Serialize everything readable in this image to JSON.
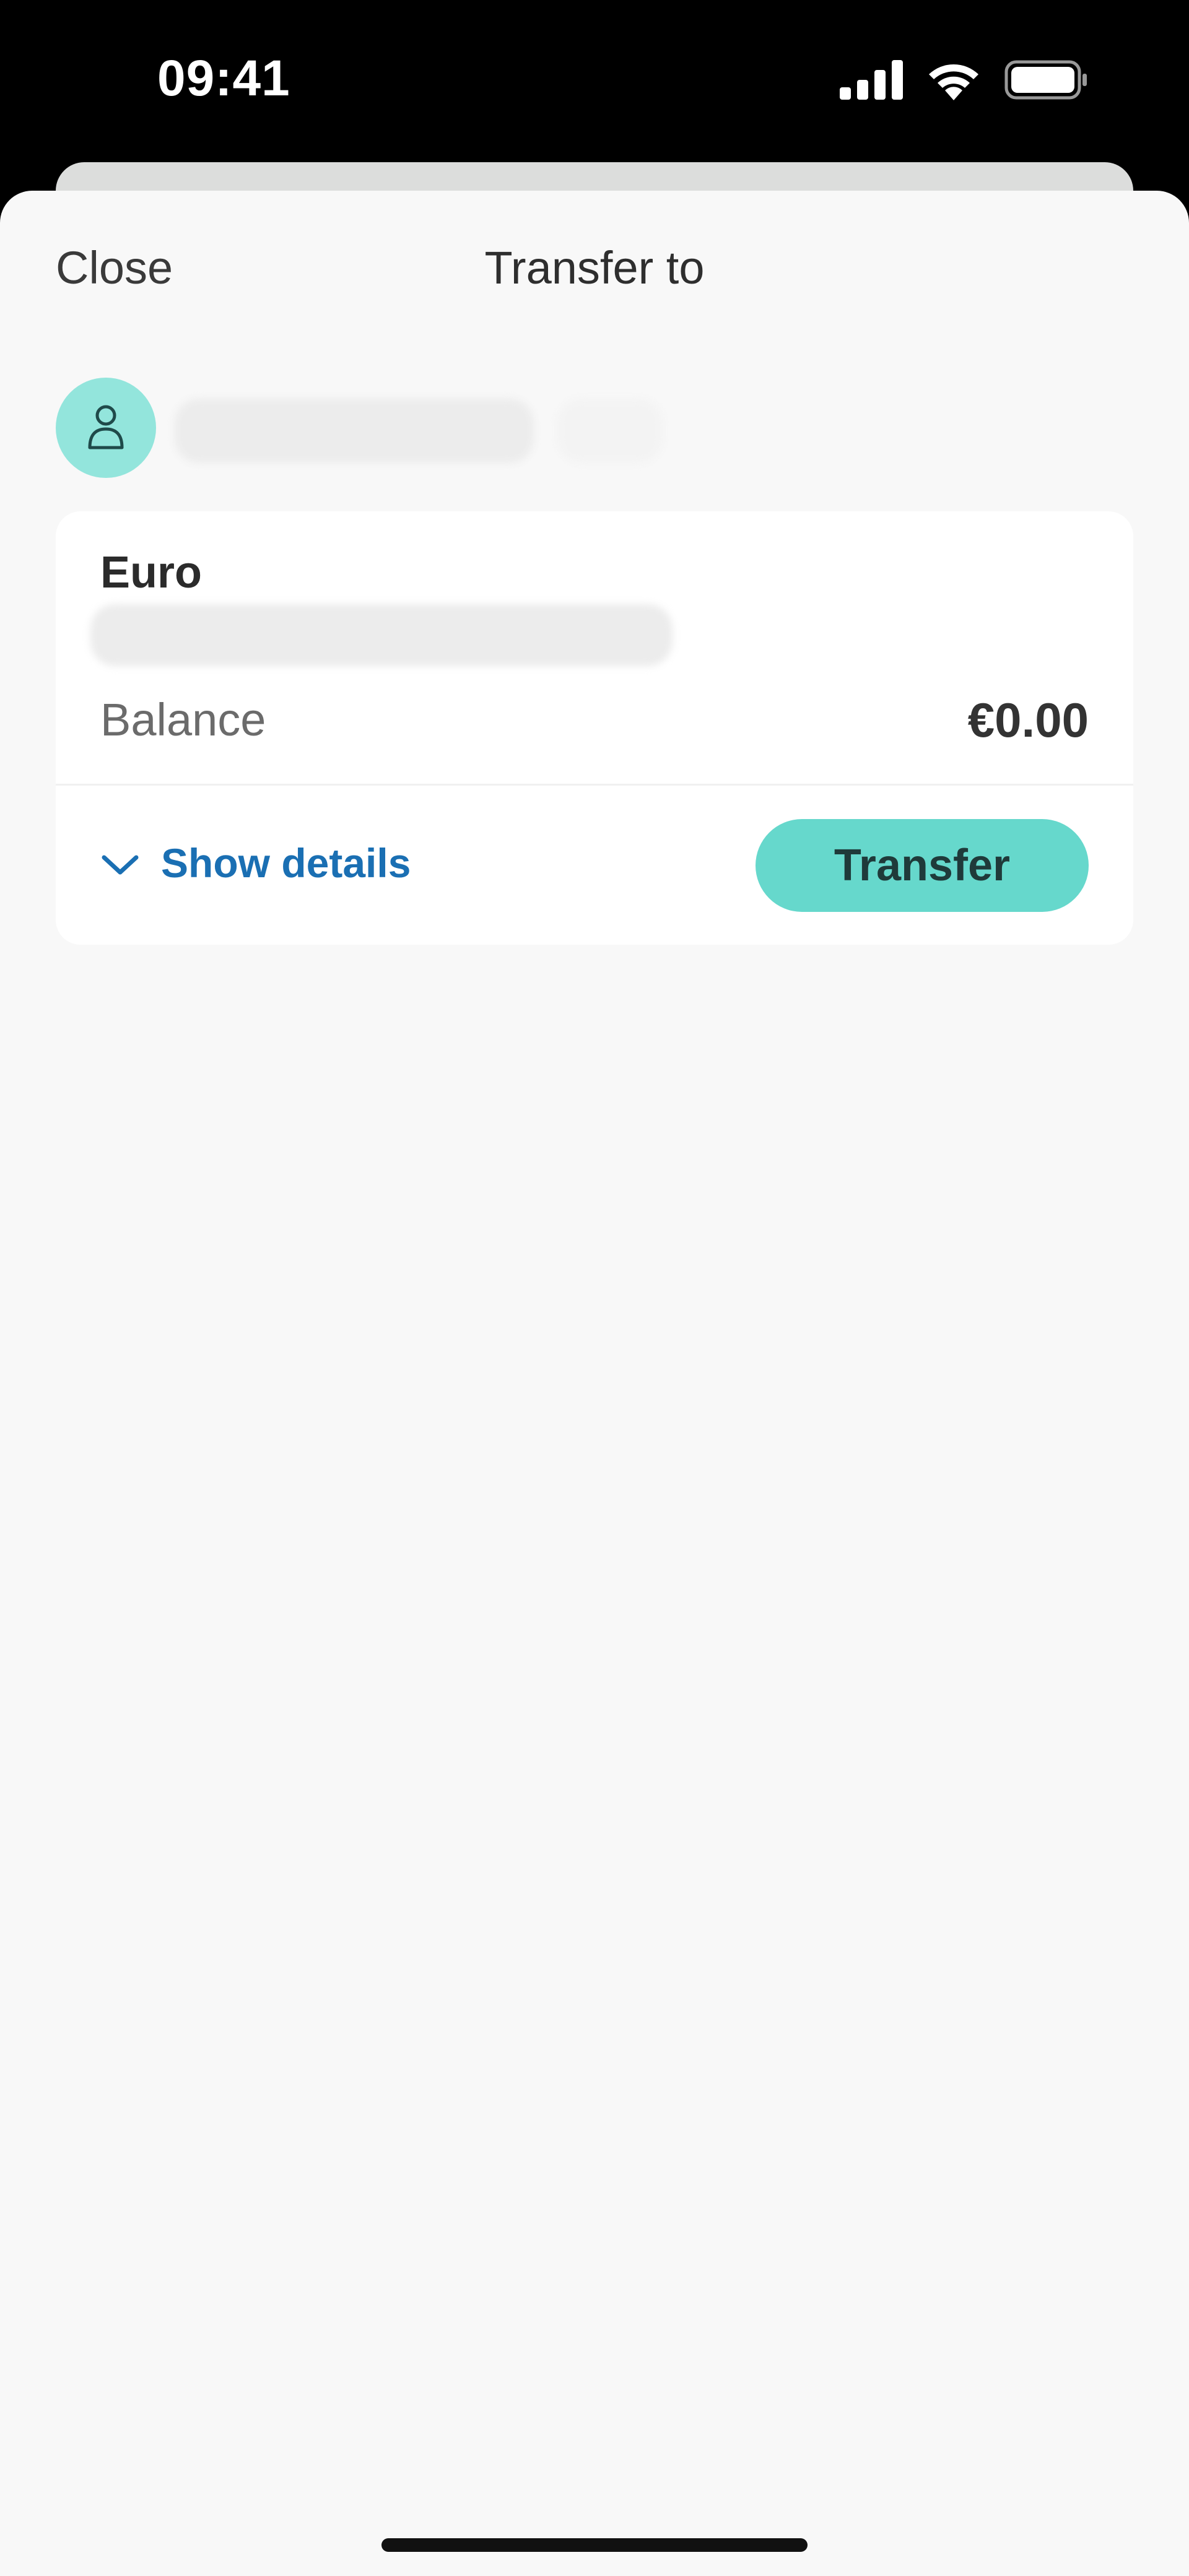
{
  "status_bar": {
    "time": "09:41",
    "icons": [
      "cellular-signal-icon",
      "wifi-icon",
      "battery-icon"
    ]
  },
  "header": {
    "close_label": "Close",
    "title": "Transfer to"
  },
  "recipient": {
    "avatar_icon": "person-icon",
    "avatar_color": "#93e5dc"
  },
  "account_card": {
    "currency_name": "Euro",
    "balance_label": "Balance",
    "balance_value": "€0.00",
    "show_details_label": "Show details",
    "transfer_button_label": "Transfer",
    "accent_color": "#66d8cc",
    "link_color": "#1a6fb3"
  }
}
